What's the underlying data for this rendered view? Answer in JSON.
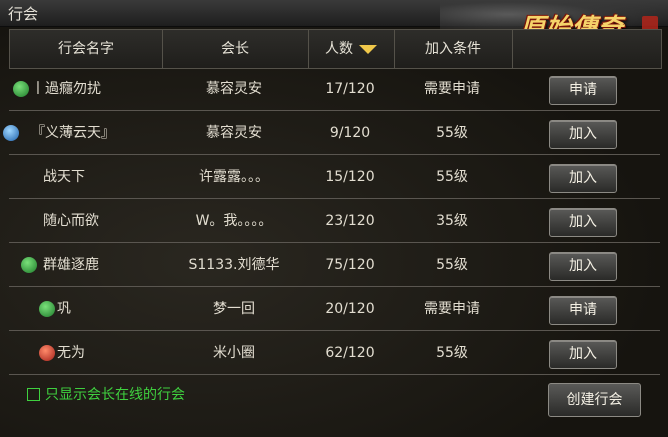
{
  "window": {
    "title": "行会"
  },
  "logo": {
    "text": "原始傳奇"
  },
  "table": {
    "headers": {
      "name": "行会名字",
      "leader": "会长",
      "members": "人数",
      "condition": "加入条件"
    },
    "rows": [
      {
        "icon": "green",
        "name": "丨過癮勿扰",
        "leader": "慕容灵安",
        "members": "17/120",
        "condition": "需要申请",
        "action": "申请"
      },
      {
        "icon": "blue",
        "name": "『义薄云天』",
        "leader": "慕容灵安",
        "members": "9/120",
        "condition": "55级",
        "action": "加入"
      },
      {
        "icon": "",
        "name": "战天下",
        "leader": "许露露。。。",
        "members": "15/120",
        "condition": "55级",
        "action": "加入"
      },
      {
        "icon": "",
        "name": "随心而欲",
        "leader": "W。我。。。。",
        "members": "23/120",
        "condition": "35级",
        "action": "加入"
      },
      {
        "icon": "green",
        "name": "群雄逐鹿",
        "leader": "S1133.刘德华",
        "members": "75/120",
        "condition": "55级",
        "action": "加入"
      },
      {
        "icon": "green",
        "name": "巩",
        "leader": "梦一回",
        "members": "20/120",
        "condition": "需要申请",
        "action": "申请"
      },
      {
        "icon": "red",
        "name": "无为",
        "leader": "米小圈",
        "members": "62/120",
        "condition": "55级",
        "action": "加入"
      }
    ]
  },
  "footer": {
    "online_only_label": "只显示会长在线的行会",
    "create_button": "创建行会"
  }
}
